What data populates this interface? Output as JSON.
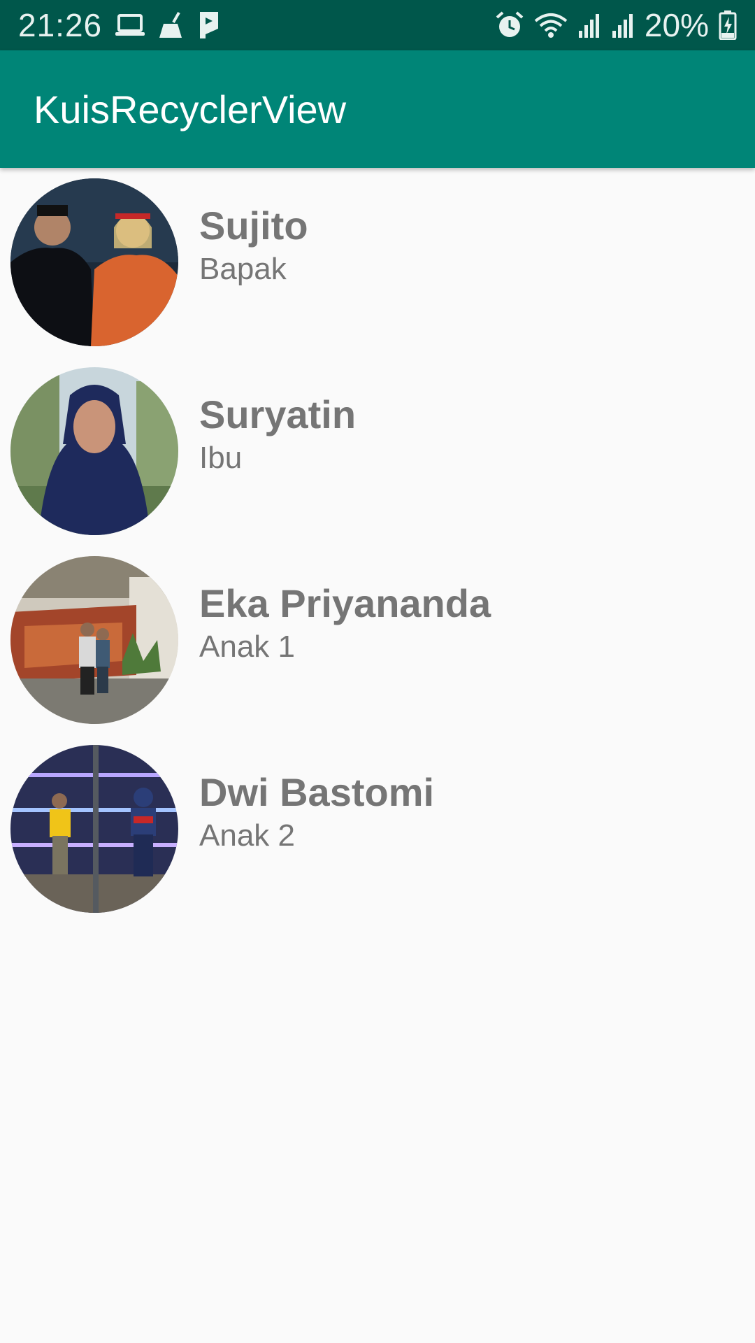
{
  "status_bar": {
    "time": "21:26",
    "battery_percent": "20%",
    "left_icons": [
      "laptop-icon",
      "broom-icon",
      "pocket-icon"
    ],
    "right_icons": [
      "alarm-icon",
      "wifi-icon",
      "signal-icon",
      "signal-icon",
      "battery-charging-icon"
    ]
  },
  "app_bar": {
    "title": "KuisRecyclerView",
    "color": "#008577"
  },
  "people": [
    {
      "name": "Sujito",
      "role": "Bapak"
    },
    {
      "name": "Suryatin",
      "role": "Ibu"
    },
    {
      "name": "Eka Priyananda",
      "role": "Anak 1"
    },
    {
      "name": "Dwi Bastomi",
      "role": "Anak 2"
    }
  ],
  "colors": {
    "status_bar": "#00574b",
    "app_bar": "#008577",
    "text": "#757575",
    "background": "#fafafa"
  }
}
